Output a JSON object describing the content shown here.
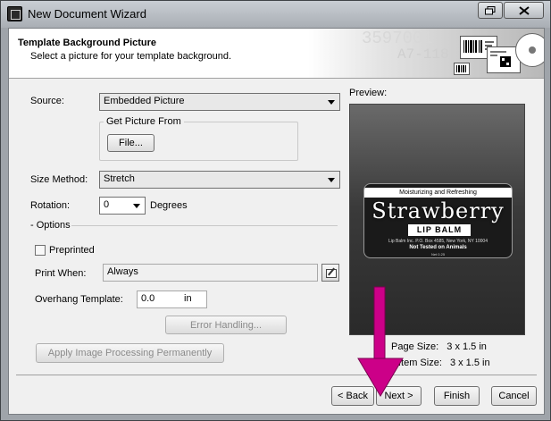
{
  "window": {
    "title": "New Document Wizard"
  },
  "header": {
    "title": "Template Background Picture",
    "subtitle": "Select a picture for your template background.",
    "art_number_1": "3597001",
    "art_number_2": "A7-118"
  },
  "form": {
    "source_label": "Source:",
    "source_value": "Embedded Picture",
    "get_picture_caption": "Get Picture From",
    "file_button": "File...",
    "size_method_label": "Size Method:",
    "size_method_value": "Stretch",
    "rotation_label": "Rotation:",
    "rotation_value": "0",
    "rotation_units": "Degrees",
    "options_caption": "Options",
    "preprinted_label": "Preprinted",
    "preprinted_checked": false,
    "print_when_label": "Print When:",
    "print_when_value": "Always",
    "overhang_label": "Overhang Template:",
    "overhang_value": "0.0",
    "overhang_units": "in",
    "error_handling_button": "Error Handling...",
    "apply_processing_button": "Apply Image Processing Permanently"
  },
  "preview": {
    "label": "Preview:",
    "label_top": "Moisturizing and Refreshing",
    "label_flavor": "Strawberry",
    "label_tag": "LIP BALM",
    "label_address": "Lip Balm Inc. P.O. Box 4585, New York, NY 10004",
    "label_tested": "Not Tested on Animals",
    "label_weight": "Net 0.25",
    "page_size_label": "Page Size:",
    "page_size_value": "3 x 1.5 in",
    "label_item_size_label": "Label Item Size:",
    "label_item_size_value": "3 x 1.5 in"
  },
  "footer": {
    "back_button": "< Back",
    "next_button": "Next >",
    "finish_button": "Finish",
    "cancel_button": "Cancel"
  },
  "annotation": {
    "arrow_color": "#cc0088"
  }
}
